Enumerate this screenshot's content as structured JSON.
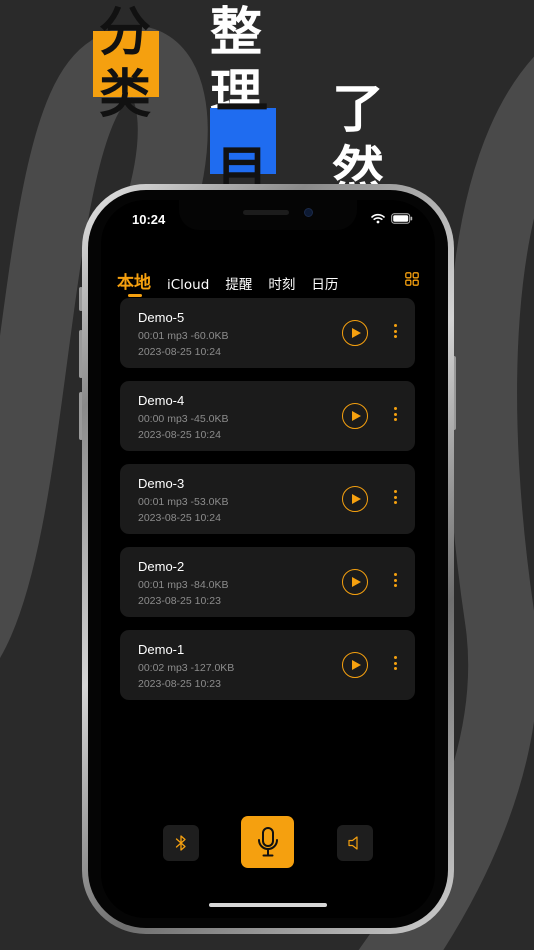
{
  "promo": {
    "line1_highlight": "分类",
    "line1_rest": "整理",
    "line2_highlight": "一目",
    "line2_rest": "了然",
    "accent_orange": "#f5a00f",
    "accent_blue": "#1f6cf0"
  },
  "status_bar": {
    "time": "10:24",
    "icons": [
      "wifi-icon",
      "battery-icon"
    ]
  },
  "tabs": [
    {
      "label": "本地",
      "active": true
    },
    {
      "label": "iCloud",
      "active": false
    },
    {
      "label": "提醒",
      "active": false
    },
    {
      "label": "时刻",
      "active": false
    },
    {
      "label": "日历",
      "active": false
    }
  ],
  "header_action_icon": "grid-icon",
  "recordings": [
    {
      "title": "Demo-5",
      "meta": "00:01 mp3 -60.0KB",
      "date": "2023-08-25 10:24"
    },
    {
      "title": "Demo-4",
      "meta": "00:00 mp3 -45.0KB",
      "date": "2023-08-25 10:24"
    },
    {
      "title": "Demo-3",
      "meta": "00:01 mp3 -53.0KB",
      "date": "2023-08-25 10:24"
    },
    {
      "title": "Demo-2",
      "meta": "00:01 mp3 -84.0KB",
      "date": "2023-08-25 10:23"
    },
    {
      "title": "Demo-1",
      "meta": "00:02 mp3 -127.0KB",
      "date": "2023-08-25 10:23"
    }
  ],
  "controls": {
    "left_icon": "bluetooth-icon",
    "center_icon": "microphone-icon",
    "right_icon": "speaker-icon"
  }
}
